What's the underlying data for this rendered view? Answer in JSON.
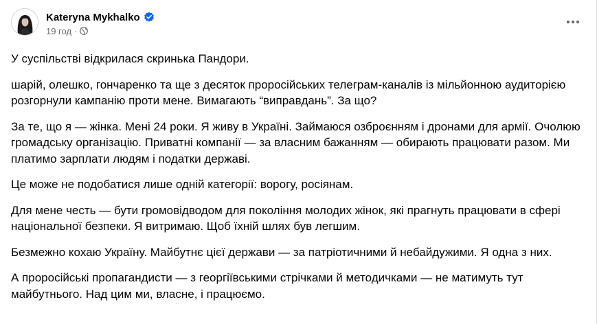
{
  "post": {
    "author": "Kateryna Mykhalko",
    "verified_icon": "verified-badge-icon",
    "time": "19 год",
    "separator": "·",
    "audience_icon": "globe-icon",
    "more_icon": "more-options-icon",
    "paragraphs": [
      "У суспільстві відкрилася скринька Пандори.",
      "шарій, олешко, гончаренко та ще з десяток проросійських телеграм-каналів із мільйонною аудиторією розгорнули кампанію проти мене. Вимагають “виправдань”. За що?",
      "За те, що я — жінка. Мені 24 роки. Я живу в Україні. Займаюся озброєнням і дронами для армії. Очолюю громадську організацію. Приватні компанії — за власним бажанням — обирають працювати разом. Ми платимо зарплати людям і податки державі.",
      "Це може не подобатися лише одній категорії: ворогу, росіянам.",
      "Для мене честь — бути громовідводом для покоління молодих жінок, які прагнуть працювати в сфері національної безпеки. Я витримаю. Щоб їхній шлях був легшим.",
      "Безмежно кохаю Україну. Майбутнє цієї держави — за патріотичними й небайдужими. Я одна з них.",
      "А проросійські пропагандисти — з георгіївськими стрічками й методичками — не матимуть тут майбутнього. Над цим ми, власне, і працюємо."
    ]
  },
  "colors": {
    "text": "#050505",
    "secondary_text": "#65676b",
    "verified_blue": "#0866ff",
    "background": "#ffffff"
  }
}
